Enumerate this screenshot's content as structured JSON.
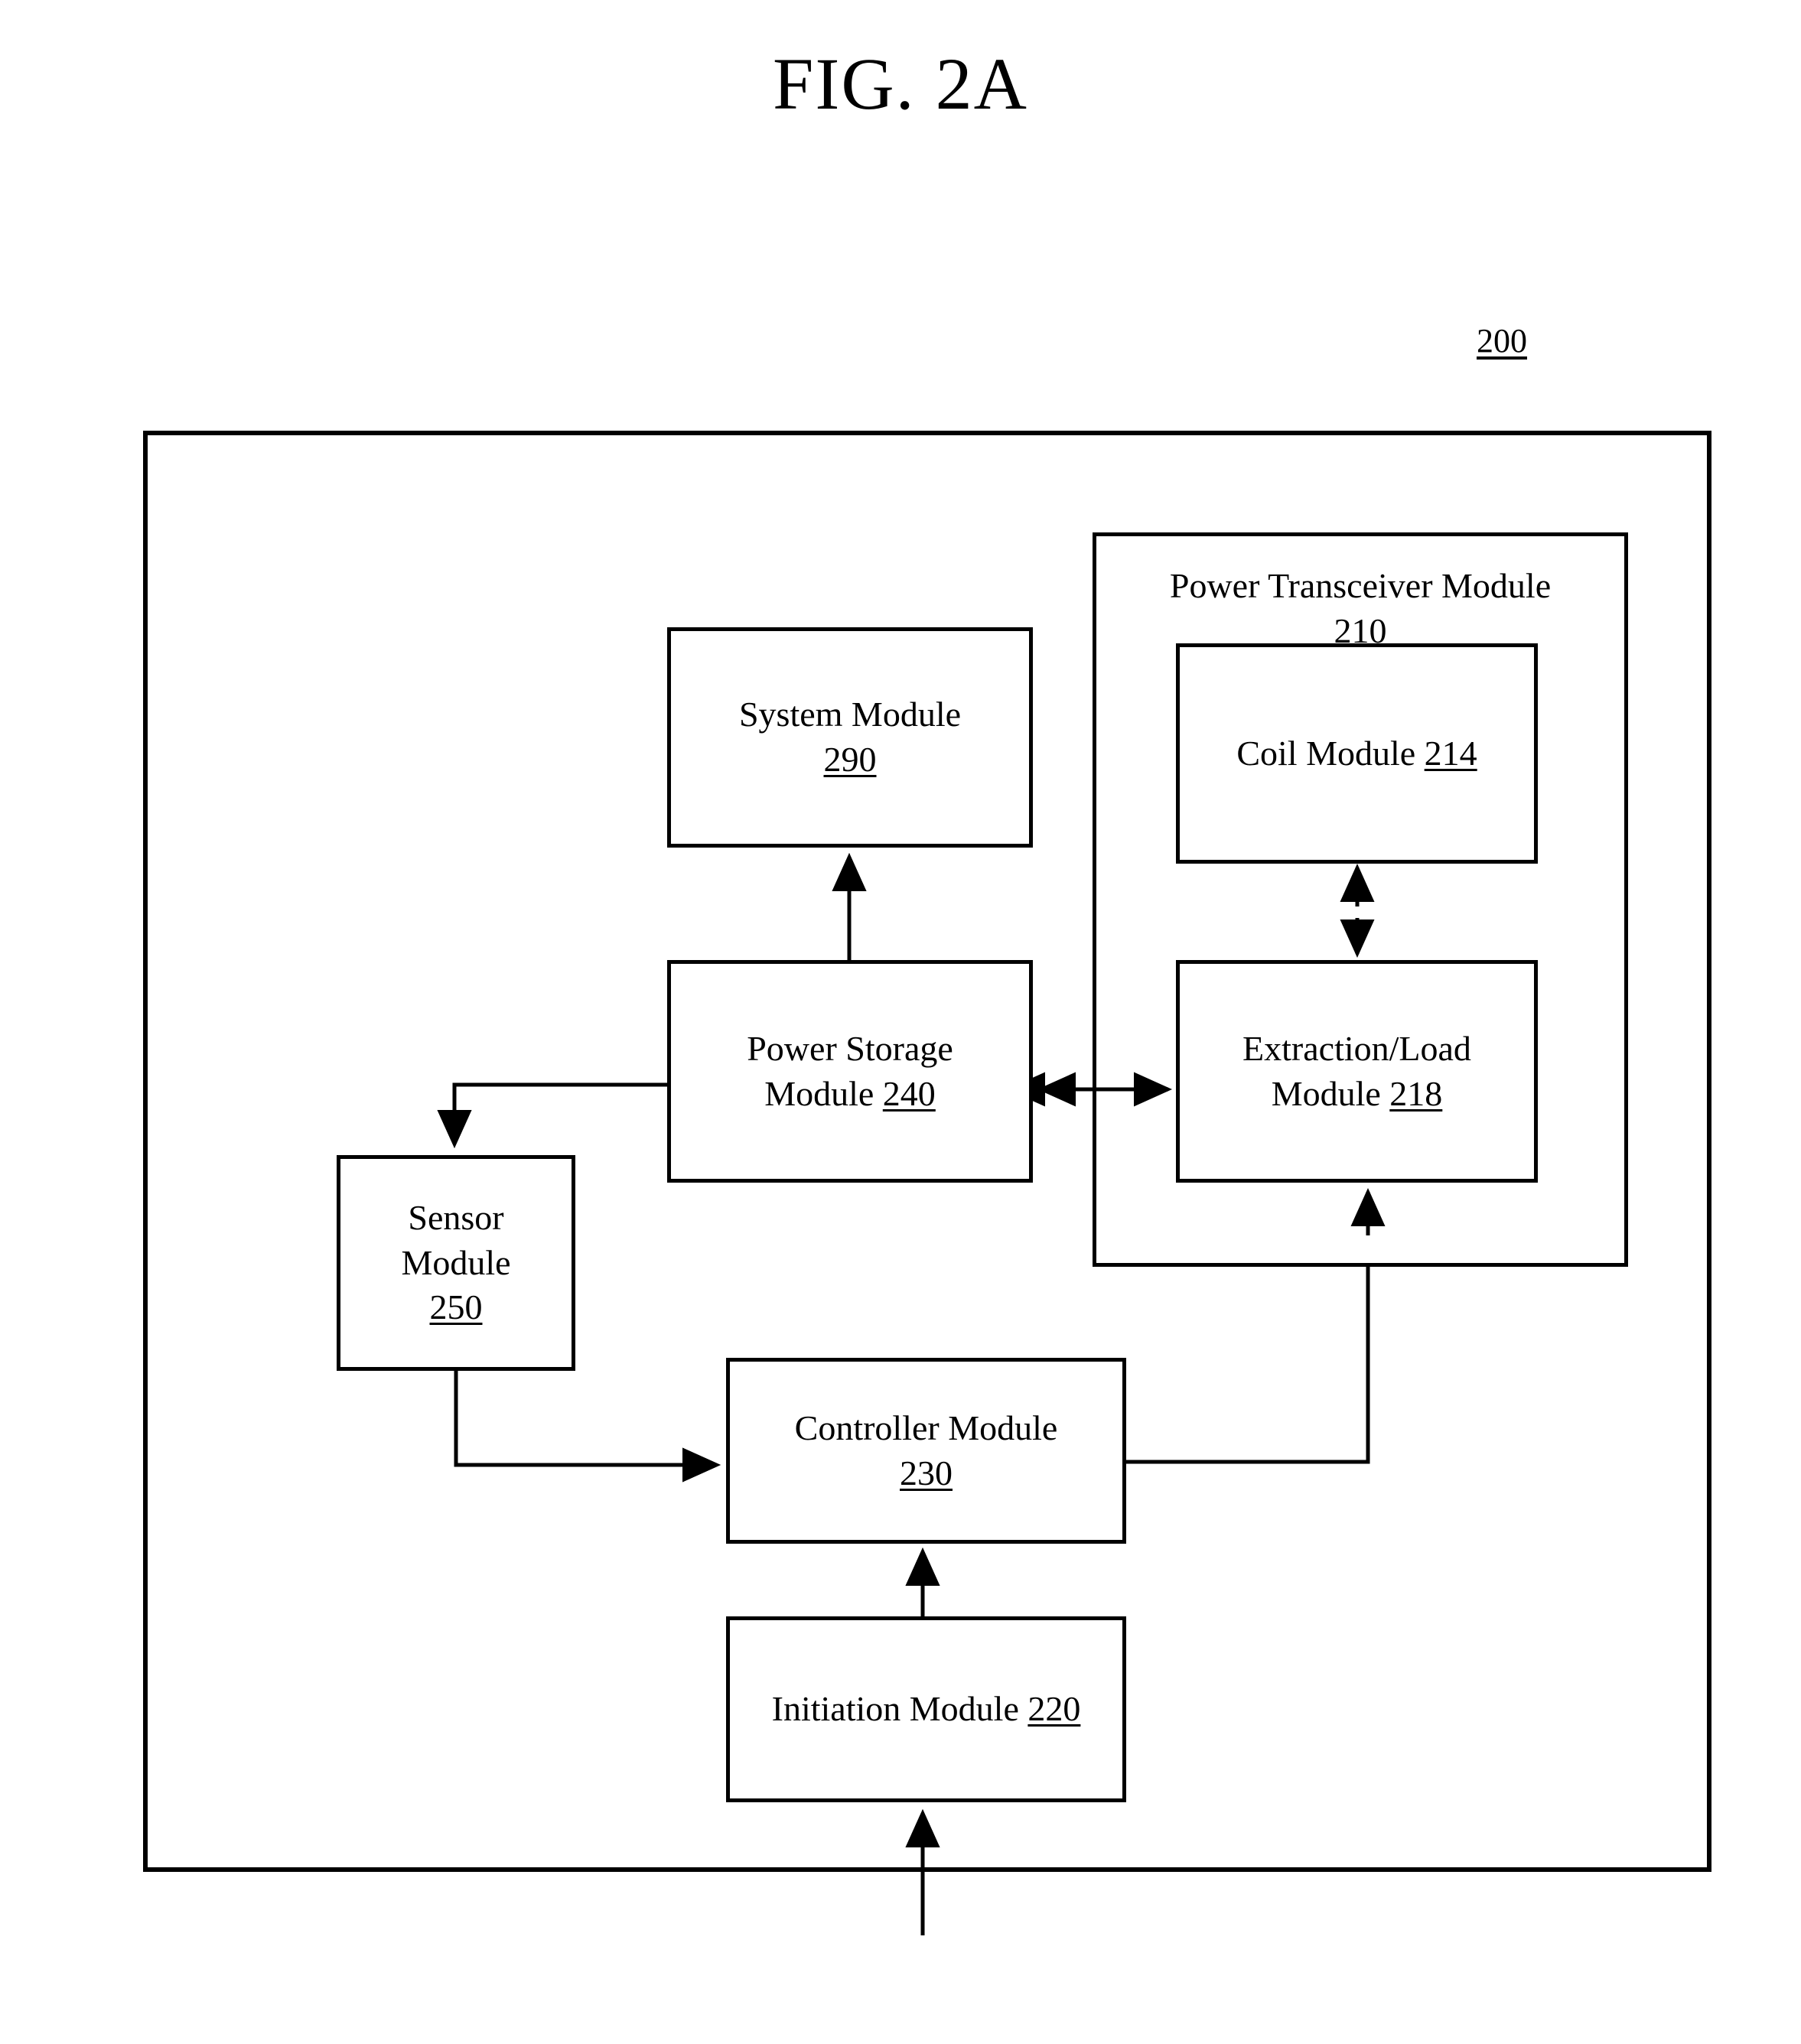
{
  "figure": {
    "title": "FIG. 2A",
    "reference_numeral": "200"
  },
  "boxes": {
    "outer_boundary": {
      "name": "system boundary",
      "label": "200"
    },
    "power_transceiver_module": {
      "line1": "Power Transceiver Module",
      "ref": "210"
    },
    "coil_module": {
      "line1": "Coil Module ",
      "ref": "214"
    },
    "system_module": {
      "line1": "System Module",
      "ref": "290"
    },
    "power_storage_module": {
      "line1": "Power Storage",
      "line2": "Module ",
      "ref": "240"
    },
    "extraction_load_module": {
      "line1": "Extraction/Load",
      "line2": "Module ",
      "ref": "218"
    },
    "sensor_module": {
      "line1": "Sensor",
      "line2": "Module",
      "ref": "250"
    },
    "controller_module": {
      "line1": "Controller Module",
      "ref": "230"
    },
    "initiation_module": {
      "line1": "Initiation Module ",
      "ref": "220"
    }
  },
  "connections": [
    {
      "from": "power_storage_module",
      "to": "system_module",
      "type": "arrow-up"
    },
    {
      "from": "power_storage_module",
      "to": "extraction_load_module",
      "type": "bidirectional"
    },
    {
      "from": "coil_module",
      "to": "extraction_load_module",
      "type": "bidirectional"
    },
    {
      "from": "power_storage_module",
      "to": "sensor_module",
      "type": "arrow-down"
    },
    {
      "from": "sensor_module",
      "to": "controller_module",
      "type": "arrow-right"
    },
    {
      "from": "controller_module",
      "to": "extraction_load_module",
      "type": "arrow-up"
    },
    {
      "from": "initiation_module",
      "to": "controller_module",
      "type": "arrow-up"
    },
    {
      "from": "external",
      "to": "initiation_module",
      "type": "arrow-up"
    }
  ],
  "colors": {
    "stroke": "#000000",
    "background": "#ffffff"
  }
}
